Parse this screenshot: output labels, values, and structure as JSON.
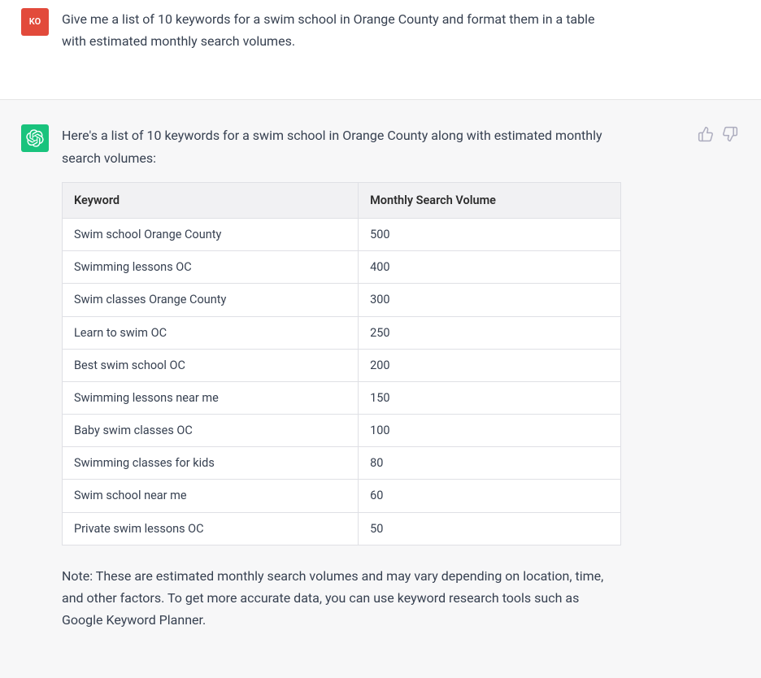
{
  "user": {
    "avatar_initials": "KO",
    "prompt": "Give me a list of 10 keywords for a swim school in Orange County and format them in a table with estimated monthly search volumes."
  },
  "assistant": {
    "intro": "Here's a list of 10 keywords for a swim school in Orange County along with estimated monthly search volumes:",
    "table": {
      "headers": {
        "keyword": "Keyword",
        "volume": "Monthly Search Volume"
      },
      "rows": [
        {
          "keyword": "Swim school Orange County",
          "volume": "500"
        },
        {
          "keyword": "Swimming lessons OC",
          "volume": "400"
        },
        {
          "keyword": "Swim classes Orange County",
          "volume": "300"
        },
        {
          "keyword": "Learn to swim OC",
          "volume": "250"
        },
        {
          "keyword": "Best swim school OC",
          "volume": "200"
        },
        {
          "keyword": "Swimming lessons near me",
          "volume": "150"
        },
        {
          "keyword": "Baby swim classes OC",
          "volume": "100"
        },
        {
          "keyword": "Swimming classes for kids",
          "volume": "80"
        },
        {
          "keyword": "Swim school near me",
          "volume": "60"
        },
        {
          "keyword": "Private swim lessons OC",
          "volume": "50"
        }
      ]
    },
    "note": "Note: These are estimated monthly search volumes and may vary depending on location, time, and other factors. To get more accurate data, you can use keyword research tools such as Google Keyword Planner."
  }
}
